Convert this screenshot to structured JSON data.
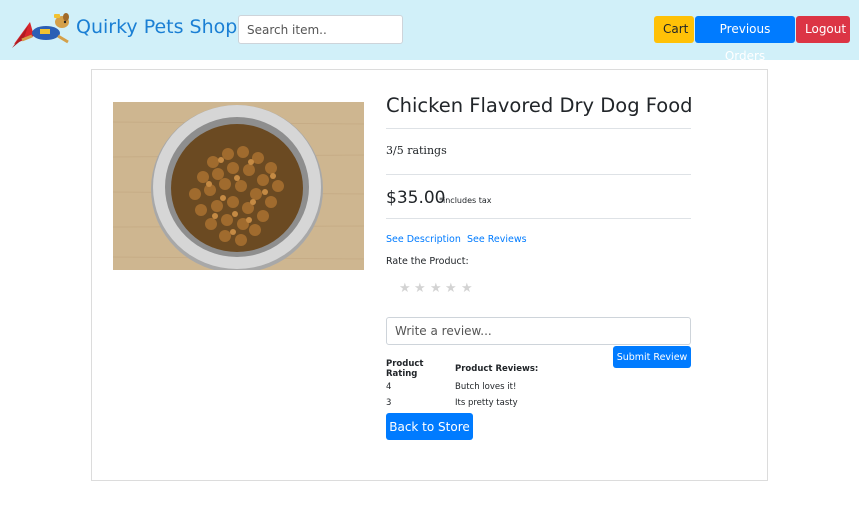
{
  "header": {
    "brand": "Quirky Pets Shoppe",
    "search_placeholder": "Search item..",
    "cart_label": "Cart",
    "orders_label": "Previous Orders",
    "logout_label": "Logout"
  },
  "product": {
    "title": "Chicken Flavored Dry Dog Food",
    "ratings_text": "3/5 ratings",
    "price": "$35.00",
    "tax_note": "*includes tax",
    "see_description": "See Description",
    "see_reviews": "See Reviews",
    "rate_label": "Rate the Product:",
    "stars_total": 5,
    "stars_selected": 0
  },
  "review_form": {
    "placeholder": "Write a review...",
    "submit_label": "Submit Review"
  },
  "reviews_table": {
    "headers": [
      "Product Rating",
      "Product Reviews:"
    ],
    "rows": [
      [
        "4",
        "Butch loves it!"
      ],
      [
        "3",
        "Its pretty tasty"
      ]
    ]
  },
  "back_label": "Back to Store",
  "colors": {
    "navbar": "#d1f0f9",
    "brand": "#1a7fd4",
    "primary": "#007bff",
    "warning": "#ffc107",
    "danger": "#dc3545"
  }
}
